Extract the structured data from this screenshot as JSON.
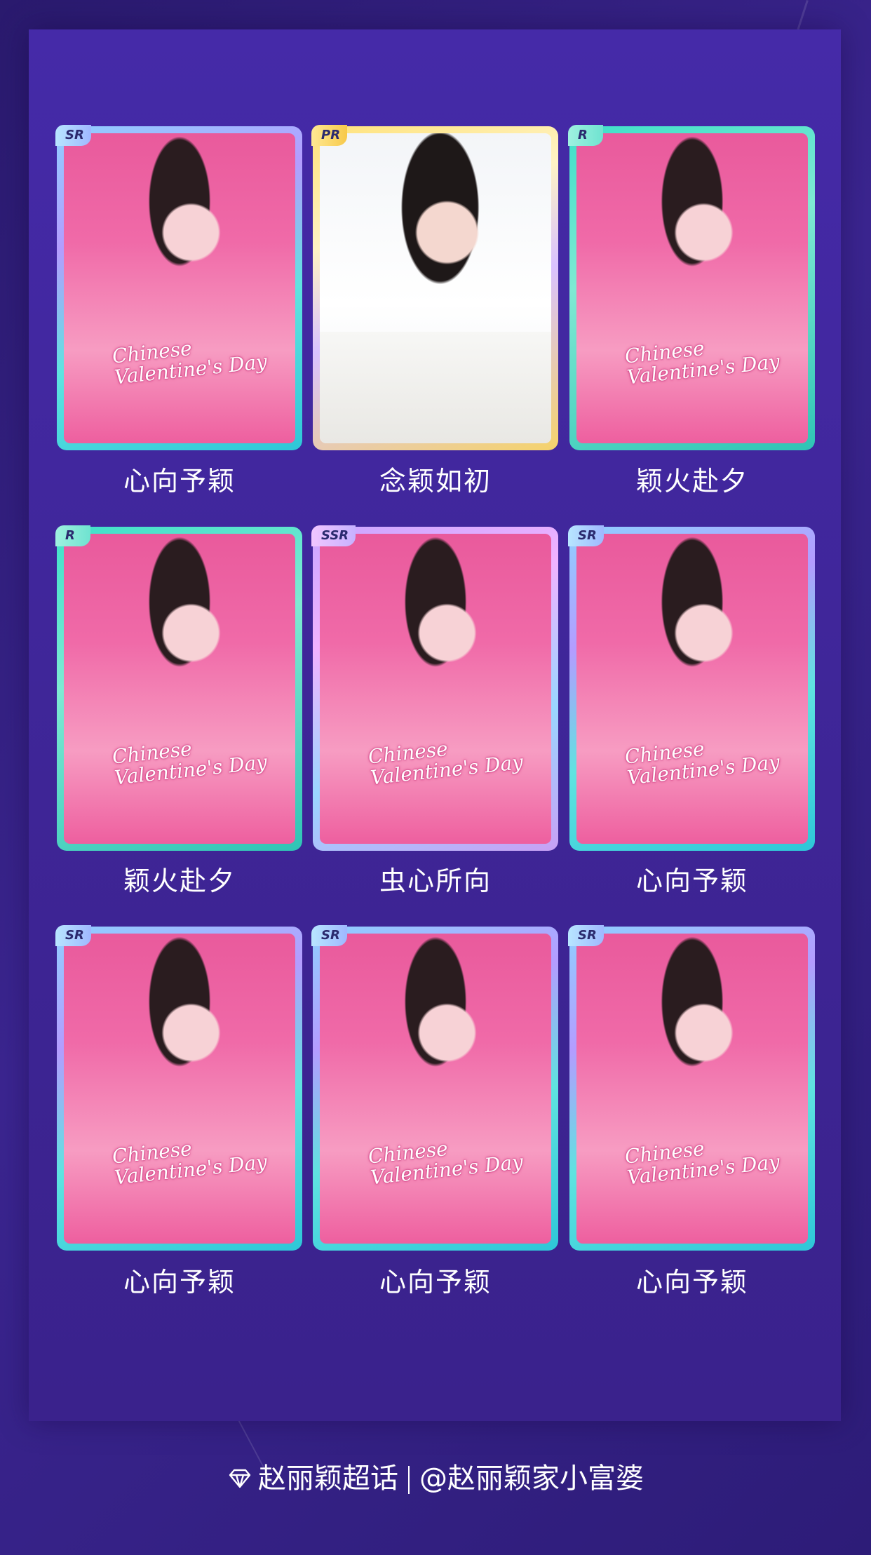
{
  "cards": [
    {
      "rarity": "SR",
      "title": "心向予颖",
      "script": "Chinese Valentine's Day"
    },
    {
      "rarity": "PR",
      "title": "念颖如初",
      "script": ""
    },
    {
      "rarity": "R",
      "title": "颖火赴夕",
      "script": "Chinese Valentine's Day"
    },
    {
      "rarity": "R",
      "title": "颖火赴夕",
      "script": "Chinese Valentine's Day"
    },
    {
      "rarity": "SSR",
      "title": "虫心所向",
      "script": "Chinese Valentine's Day"
    },
    {
      "rarity": "SR",
      "title": "心向予颖",
      "script": "Chinese Valentine's Day"
    },
    {
      "rarity": "SR",
      "title": "心向予颖",
      "script": "Chinese Valentine's Day"
    },
    {
      "rarity": "SR",
      "title": "心向予颖",
      "script": "Chinese Valentine's Day"
    },
    {
      "rarity": "SR",
      "title": "心向予颖",
      "script": "Chinese Valentine's Day"
    }
  ],
  "footer": {
    "icon": "diamond-icon",
    "left": "赵丽颖超话",
    "right": "@赵丽颖家小富婆"
  }
}
